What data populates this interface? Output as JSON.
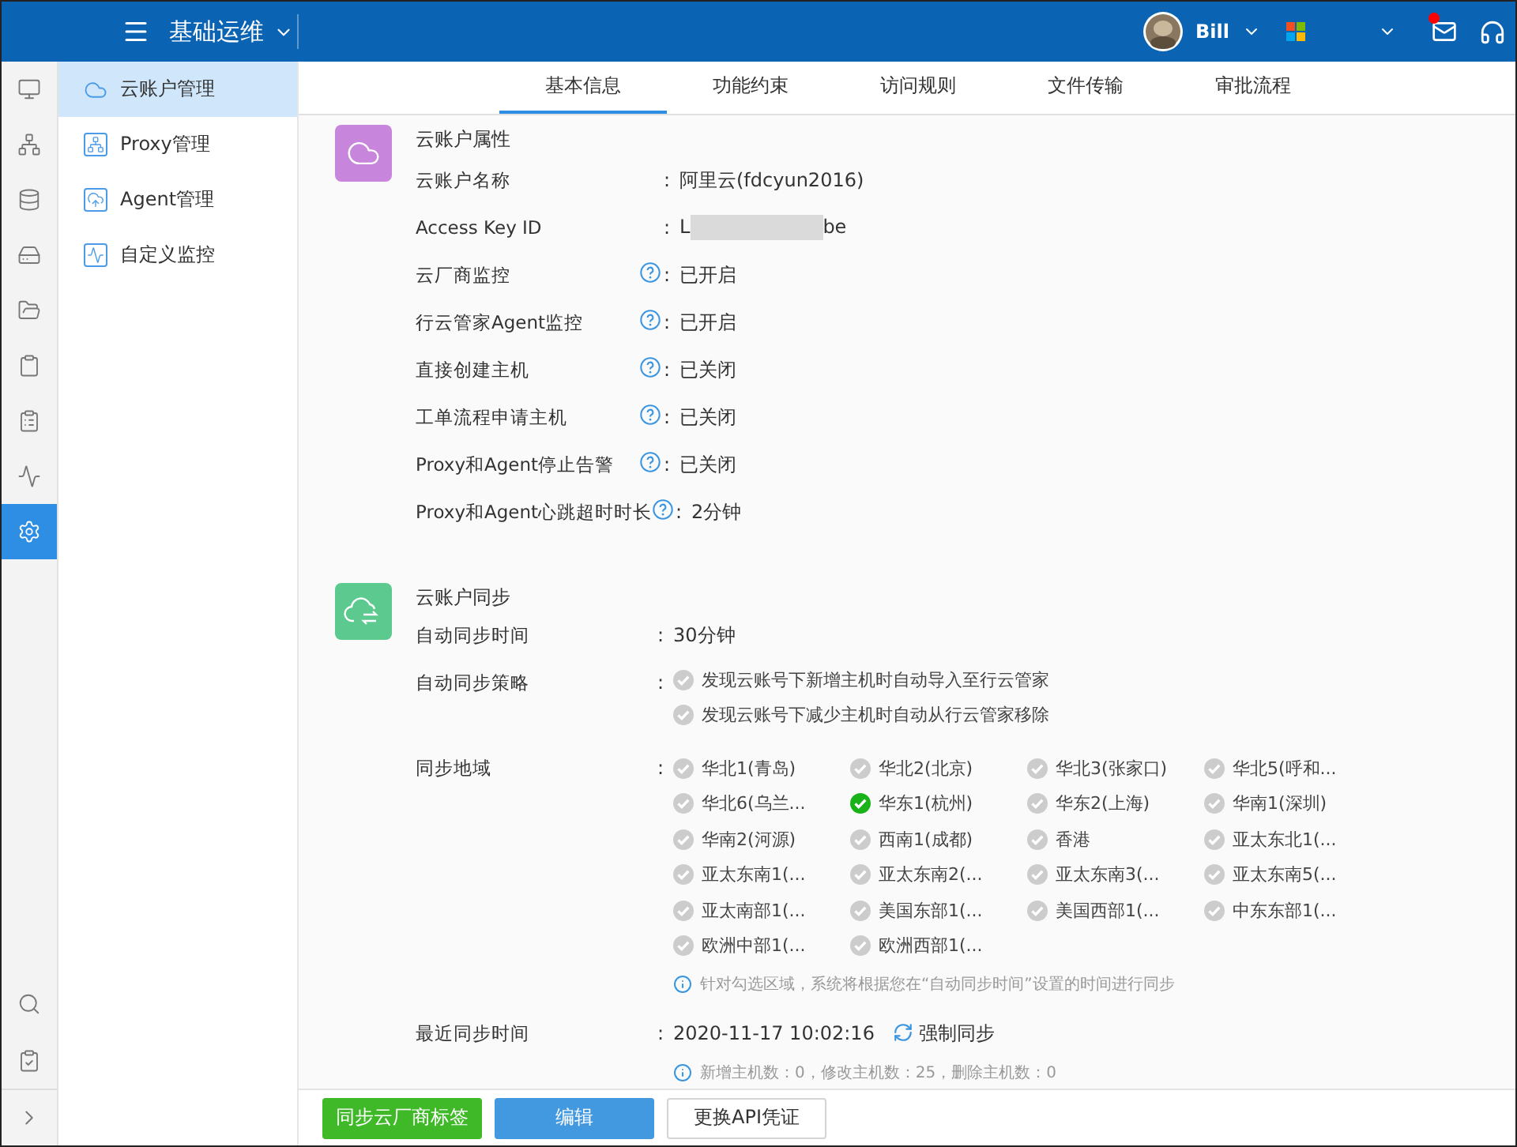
{
  "topbar": {
    "title": "基础运维",
    "user": "Bill",
    "has_unread_mail": true
  },
  "rail": {
    "items": [
      {
        "kind": "monitor",
        "selected": false
      },
      {
        "kind": "network",
        "selected": false
      },
      {
        "kind": "database",
        "selected": false
      },
      {
        "kind": "drive",
        "selected": false
      },
      {
        "kind": "folder",
        "selected": false
      },
      {
        "kind": "clipboard",
        "selected": false
      },
      {
        "kind": "clipboard-list",
        "selected": false
      },
      {
        "kind": "pulse",
        "selected": false
      },
      {
        "kind": "settings",
        "selected": true
      }
    ],
    "bottom": [
      {
        "kind": "search"
      },
      {
        "kind": "clipboard-check"
      },
      {
        "kind": "expand"
      }
    ]
  },
  "submenu": [
    {
      "label": "云账户管理",
      "kind": "cloud",
      "selected": true
    },
    {
      "label": "Proxy管理",
      "kind": "network",
      "selected": false
    },
    {
      "label": "Agent管理",
      "kind": "agent",
      "selected": false
    },
    {
      "label": "自定义监控",
      "kind": "pulse",
      "selected": false
    }
  ],
  "tabs": [
    {
      "label": "基本信息",
      "selected": true
    },
    {
      "label": "功能约束",
      "selected": false
    },
    {
      "label": "访问规则",
      "selected": false
    },
    {
      "label": "文件传输",
      "selected": false
    },
    {
      "label": "审批流程",
      "selected": false
    }
  ],
  "account_properties": {
    "title": "云账户属性",
    "rows": [
      {
        "label": "云账户名称",
        "help": false,
        "sep": ":",
        "value": "阿里云(fdcyun2016)"
      },
      {
        "label": "Access Key ID",
        "help": false,
        "sep": ":",
        "value": "L",
        "redacted": true,
        "value_end": "be"
      },
      {
        "label": "云厂商监控",
        "help": true,
        "sep": ":",
        "value": "已开启"
      },
      {
        "label": "行云管家Agent监控",
        "help": true,
        "sep": ":",
        "value": "已开启"
      },
      {
        "label": "直接创建主机",
        "help": true,
        "sep": ":",
        "value": "已关闭"
      },
      {
        "label": "工单流程申请主机",
        "help": true,
        "sep": ":",
        "value": "已关闭"
      },
      {
        "label": "Proxy和Agent停止告警",
        "help": true,
        "sep": ":",
        "value": "已关闭"
      },
      {
        "label": "Proxy和Agent心跳超时时长",
        "help": true,
        "sep": ":",
        "value": "2分钟"
      }
    ]
  },
  "account_sync": {
    "title": "云账户同步",
    "interval": {
      "label": "自动同步时间",
      "sep": ":",
      "value": "30分钟"
    },
    "policy": {
      "label": "自动同步策略",
      "sep": ":",
      "options": [
        {
          "label": "发现云账号下新增主机时自动导入至行云管家",
          "checked": false
        },
        {
          "label": "发现云账号下减少主机时自动从行云管家移除",
          "checked": false
        }
      ]
    },
    "regions": {
      "label": "同步地域",
      "sep": ":",
      "items": [
        {
          "label": "华北1(青岛)",
          "checked": false
        },
        {
          "label": "华北2(北京)",
          "checked": false
        },
        {
          "label": "华北3(张家口)",
          "checked": false
        },
        {
          "label": "华北5(呼和...",
          "checked": false
        },
        {
          "label": "华北6(乌兰...",
          "checked": false
        },
        {
          "label": "华东1(杭州)",
          "checked": true
        },
        {
          "label": "华东2(上海)",
          "checked": false
        },
        {
          "label": "华南1(深圳)",
          "checked": false
        },
        {
          "label": "华南2(河源)",
          "checked": false
        },
        {
          "label": "西南1(成都)",
          "checked": false
        },
        {
          "label": "香港",
          "checked": false
        },
        {
          "label": "亚太东北1(...",
          "checked": false
        },
        {
          "label": "亚太东南1(...",
          "checked": false
        },
        {
          "label": "亚太东南2(...",
          "checked": false
        },
        {
          "label": "亚太东南3(...",
          "checked": false
        },
        {
          "label": "亚太东南5(...",
          "checked": false
        },
        {
          "label": "亚太南部1(...",
          "checked": false
        },
        {
          "label": "美国东部1(...",
          "checked": false
        },
        {
          "label": "美国西部1(...",
          "checked": false
        },
        {
          "label": "中东东部1(...",
          "checked": false
        },
        {
          "label": "欧洲中部1(...",
          "checked": false
        },
        {
          "label": "欧洲西部1(...",
          "checked": false
        }
      ],
      "note": "针对勾选区域，系统将根据您在“自动同步时间”设置的时间进行同步"
    },
    "last_sync": {
      "label": "最近同步时间",
      "sep": ":",
      "value": "2020-11-17 10:02:16",
      "action": "强制同步",
      "stats": "新增主机数：0，修改主机数：25，删除主机数：0"
    }
  },
  "buttons": [
    {
      "label": "同步云厂商标签",
      "kind": "success"
    },
    {
      "label": "编辑",
      "kind": "primary"
    },
    {
      "label": "更换API凭证",
      "kind": "default"
    }
  ]
}
